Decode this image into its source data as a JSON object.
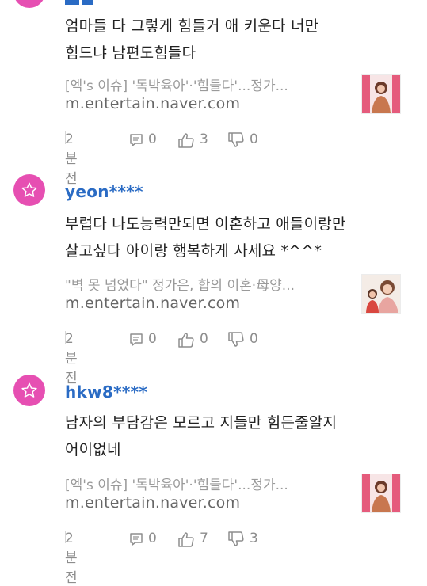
{
  "comments": [
    {
      "username": "",
      "text": "엄마들 다 그렇게 힘들거 애 키운다 너만\n힘드냐 남편도힘들다",
      "link_title": "[엑's 이슈] '독박육아'·'힘들다'...정가...",
      "link_url": "m.entertain.naver.com",
      "time": "2분 전",
      "replies": "0",
      "likes": "3",
      "dislikes": "0"
    },
    {
      "username": "yeon****",
      "text": "부럽다 나도능력만되면 이혼하고 애들이랑만\n살고싶다 아이랑 행복하게 사세요 *^^*",
      "link_title": "\"벽 못 넘었다\" 정가은, 합의 이혼·母양...",
      "link_url": "m.entertain.naver.com",
      "time": "2분 전",
      "replies": "0",
      "likes": "0",
      "dislikes": "0"
    },
    {
      "username": "hkw8****",
      "text": "남자의 부담감은 모르고 지들만 힘든줄알지\n어이없네",
      "link_title": "[엑's 이슈] '독박육아'·'힘들다'...정가...",
      "link_url": "m.entertain.naver.com",
      "time": "2분 전",
      "replies": "0",
      "likes": "7",
      "dislikes": "3"
    }
  ],
  "colors": {
    "avatar": "#e64fb2",
    "username": "#2a6bc4"
  },
  "icons": [
    "star-icon",
    "reply-icon",
    "thumbs-up-icon",
    "thumbs-down-icon"
  ]
}
